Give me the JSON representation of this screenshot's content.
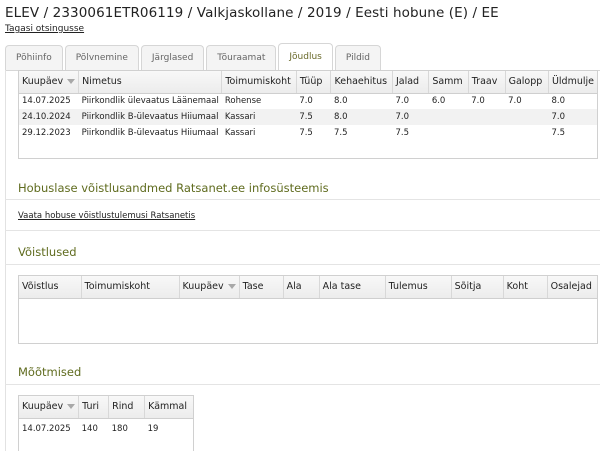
{
  "header": {
    "title": "ELEV / 2330061ETR06119 / Valkjaskollane / 2019 / Eesti hobune (E) / EE",
    "back_link": "Tagasi otsingusse"
  },
  "tabs": [
    "Põhiinfo",
    "Põlvnemine",
    "Järglased",
    "Tõuraamat",
    "Jõudlus",
    "Pildid"
  ],
  "active_tab": "Jõudlus",
  "evaluations": {
    "columns": [
      "Kuupäev",
      "Nimetus",
      "Toimumiskoht",
      "Tüüp",
      "Kehaehitus",
      "Jalad",
      "Samm",
      "Traav",
      "Galopp",
      "Üldmulje"
    ],
    "rows": [
      [
        "14.07.2025",
        "Piirkondlik ülevaatus Läänemaal",
        "Rohense",
        "7.0",
        "8.0",
        "7.0",
        "6.0",
        "7.0",
        "7.0",
        "8.0"
      ],
      [
        "24.10.2024",
        "Piirkondlik B-ülevaatus Hiiumaal",
        "Kassari",
        "7.5",
        "8.0",
        "7.0",
        "",
        "",
        "",
        "7.0"
      ],
      [
        "29.12.2023",
        "Piirkondlik B-ülevaatus Hiiumaal",
        "Kassari",
        "7.5",
        "7.5",
        "7.5",
        "",
        "",
        "",
        "7.5"
      ]
    ]
  },
  "racing_info": {
    "title": "Hobuslase võistlusandmed Ratsanet.ee infosüsteemis",
    "link": "Vaata hobuse võistlustulemusi Ratsanetis"
  },
  "competitions": {
    "title": "Võistlused",
    "columns": [
      "Võistlus",
      "Toimumiskoht",
      "Kuupäev",
      "Tase",
      "Ala",
      "Ala tase",
      "Tulemus",
      "Sõitja",
      "Koht",
      "Osalejad"
    ]
  },
  "measurements": {
    "title": "Mõõtmised",
    "columns": [
      "Kuupäev",
      "Turi",
      "Rind",
      "Kämmal"
    ],
    "rows": [
      [
        "14.07.2025",
        "140",
        "180",
        "19"
      ]
    ]
  }
}
